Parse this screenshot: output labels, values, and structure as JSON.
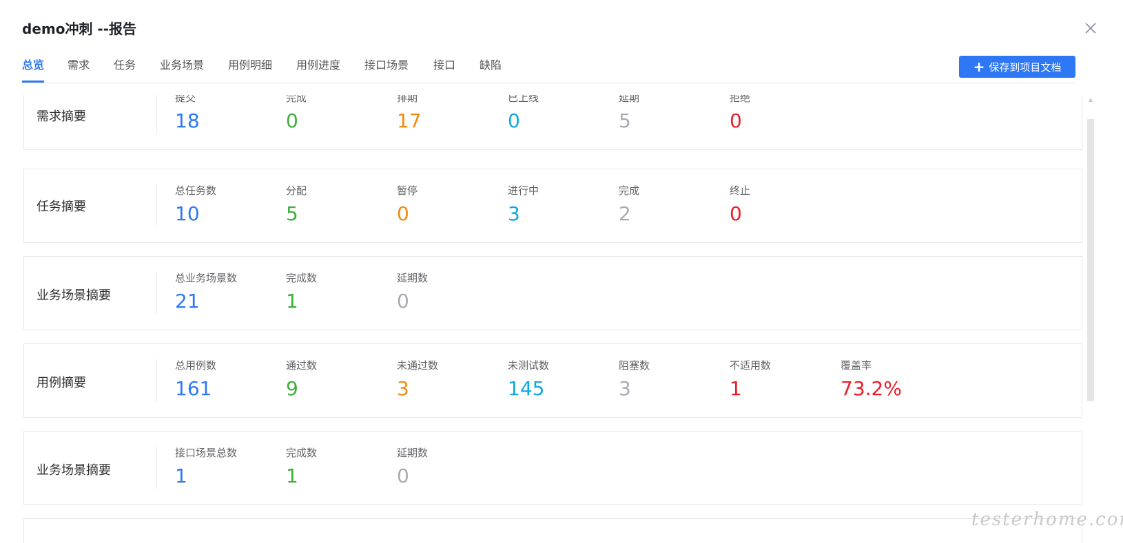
{
  "dialog": {
    "title": "demo冲刺 --报告"
  },
  "tabs": [
    {
      "label": "总览",
      "active": true
    },
    {
      "label": "需求"
    },
    {
      "label": "任务"
    },
    {
      "label": "业务场景"
    },
    {
      "label": "用例明细"
    },
    {
      "label": "用例进度"
    },
    {
      "label": "接口场景"
    },
    {
      "label": "接口"
    },
    {
      "label": "缺陷"
    }
  ],
  "save_button": {
    "label": "保存到项目文档",
    "icon": "plus-icon"
  },
  "colors": {
    "blue": "#2e78f5",
    "green": "#3daf3b",
    "orange": "#f28b12",
    "cyan": "#10a8e0",
    "gray": "#a8abb2",
    "red": "#ee1d26"
  },
  "cards": [
    {
      "label": "需求摘要",
      "stats": [
        {
          "label": "提交",
          "value": "18",
          "color": "#2e78f5"
        },
        {
          "label": "完成",
          "value": "0",
          "color": "#3daf3b"
        },
        {
          "label": "排期",
          "value": "17",
          "color": "#f28b12"
        },
        {
          "label": "已上线",
          "value": "0",
          "color": "#10a8e0"
        },
        {
          "label": "延期",
          "value": "5",
          "color": "#a8abb2"
        },
        {
          "label": "拒绝",
          "value": "0",
          "color": "#ee1d26"
        }
      ]
    },
    {
      "label": "任务摘要",
      "stats": [
        {
          "label": "总任务数",
          "value": "10",
          "color": "#2e78f5"
        },
        {
          "label": "分配",
          "value": "5",
          "color": "#3daf3b"
        },
        {
          "label": "暂停",
          "value": "0",
          "color": "#f28b12"
        },
        {
          "label": "进行中",
          "value": "3",
          "color": "#10a8e0"
        },
        {
          "label": "完成",
          "value": "2",
          "color": "#a8abb2"
        },
        {
          "label": "终止",
          "value": "0",
          "color": "#ee1d26"
        }
      ]
    },
    {
      "label": "业务场景摘要",
      "stats": [
        {
          "label": "总业务场景数",
          "value": "21",
          "color": "#2e78f5"
        },
        {
          "label": "完成数",
          "value": "1",
          "color": "#3daf3b"
        },
        {
          "label": "延期数",
          "value": "0",
          "color": "#a8abb2"
        }
      ]
    },
    {
      "label": "用例摘要",
      "stats": [
        {
          "label": "总用例数",
          "value": "161",
          "color": "#2e78f5"
        },
        {
          "label": "通过数",
          "value": "9",
          "color": "#3daf3b"
        },
        {
          "label": "未通过数",
          "value": "3",
          "color": "#f28b12"
        },
        {
          "label": "未测试数",
          "value": "145",
          "color": "#10a8e0"
        },
        {
          "label": "阻塞数",
          "value": "3",
          "color": "#a8abb2"
        },
        {
          "label": "不适用数",
          "value": "1",
          "color": "#ee1d26"
        },
        {
          "label": "覆盖率",
          "value": "73.2%",
          "color": "#ee1d26"
        }
      ]
    },
    {
      "label": "业务场景摘要",
      "stats": [
        {
          "label": "接口场景总数",
          "value": "1",
          "color": "#2e78f5"
        },
        {
          "label": "完成数",
          "value": "1",
          "color": "#3daf3b"
        },
        {
          "label": "延期数",
          "value": "0",
          "color": "#a8abb2"
        }
      ]
    }
  ],
  "watermark": "testerhome.com"
}
